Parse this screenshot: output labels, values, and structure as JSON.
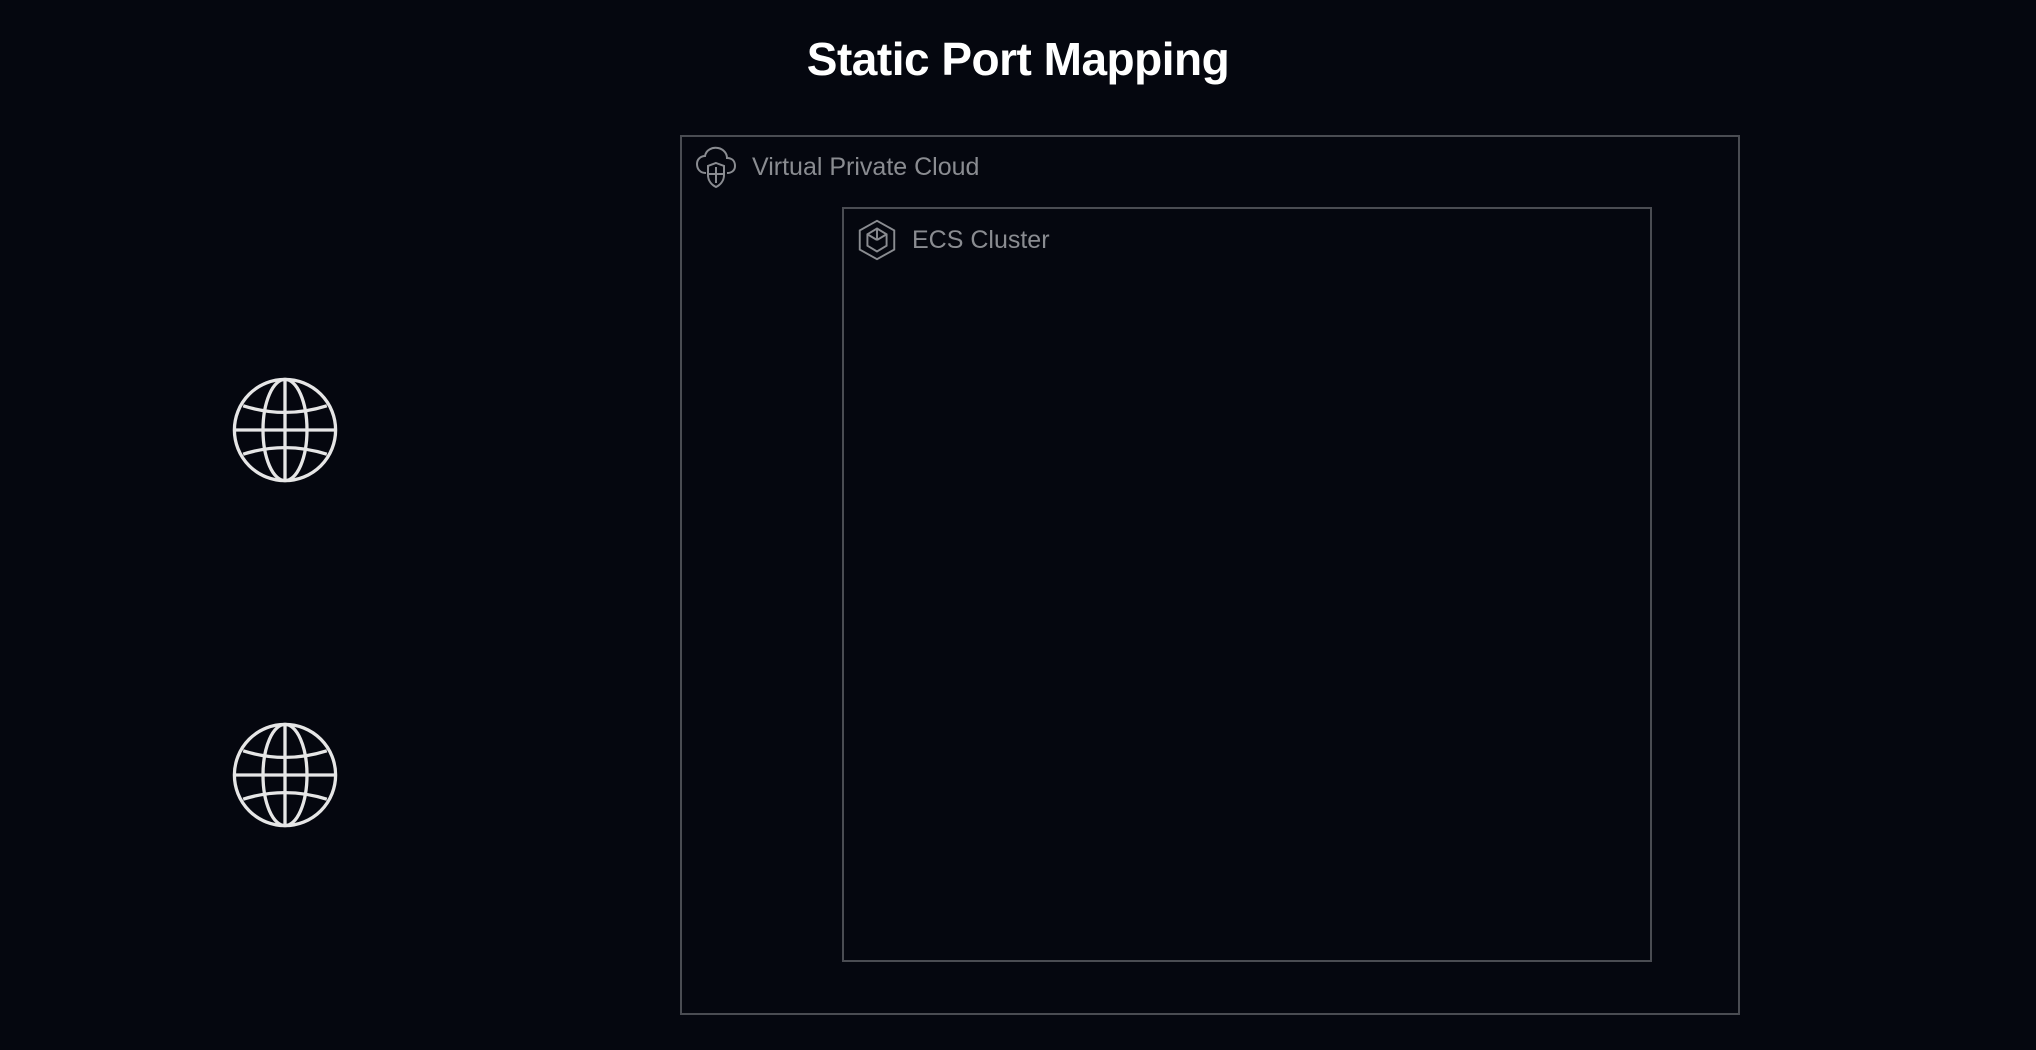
{
  "title": "Static Port Mapping",
  "vpc": {
    "label": "Virtual Private Cloud",
    "icon_name": "cloud-shield-icon"
  },
  "ecs": {
    "label": "ECS Cluster",
    "icon_name": "hex-container-icon"
  },
  "globes": [
    {
      "name": "globe-icon-1"
    },
    {
      "name": "globe-icon-2"
    }
  ],
  "colors": {
    "background": "#05070f",
    "border": "#4a4c52",
    "label_text": "#8a8c91",
    "title_text": "#ffffff",
    "icon_stroke": "#e6e6e6"
  }
}
